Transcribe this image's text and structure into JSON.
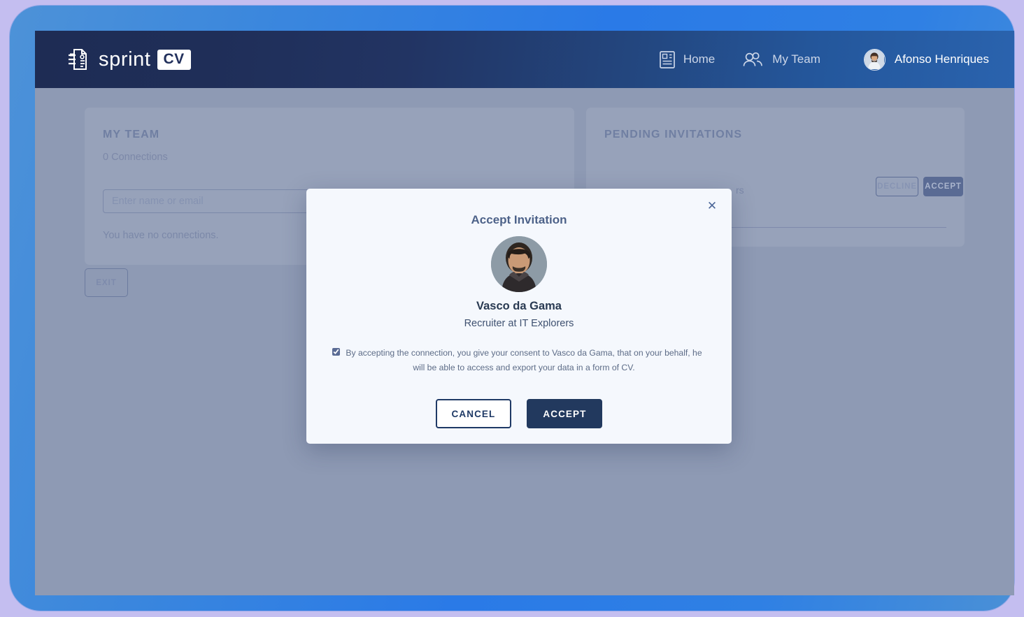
{
  "brand": {
    "name": "sprint",
    "badge": "CV",
    "logo_icon": "document-list-icon"
  },
  "nav": {
    "items": [
      {
        "label": "Home",
        "icon": "id-card-icon"
      },
      {
        "label": "My Team",
        "icon": "people-group-icon"
      }
    ],
    "user": {
      "name": "Afonso Henriques",
      "avatar_icon": "user-avatar"
    }
  },
  "panels": {
    "team": {
      "title": "MY TEAM",
      "connections": "0 Connections",
      "search_placeholder": "Enter name or email",
      "search_value": "",
      "empty_message": "You have no connections."
    },
    "pending": {
      "title": "PENDING INVITATIONS",
      "role_fragment": "rs",
      "decline_label": "DECLINE",
      "accept_label": "ACCEPT"
    }
  },
  "exit_button": "EXIT",
  "modal": {
    "title": "Accept Invitation",
    "close_icon": "close-icon",
    "person_name": "Vasco da Gama",
    "person_role": "Recruiter at IT Explorers",
    "consent_checked": true,
    "consent_text": "By accepting the connection, you give your consent to Vasco da Gama, that on your behalf, he will be able to access and export your data in a form of CV.",
    "cancel_label": "CANCEL",
    "accept_label": "ACCEPT"
  },
  "colors": {
    "page_backdrop": "#c4bef0",
    "device_frame": "#2a7ae7",
    "topbar_dark": "#1e2c54",
    "topbar_light": "#2a63ae",
    "content_overlay": "#8e9ab4",
    "modal_bg": "#f5f8fd",
    "accept_button": "#22395e",
    "cancel_border": "#1f3a66"
  }
}
